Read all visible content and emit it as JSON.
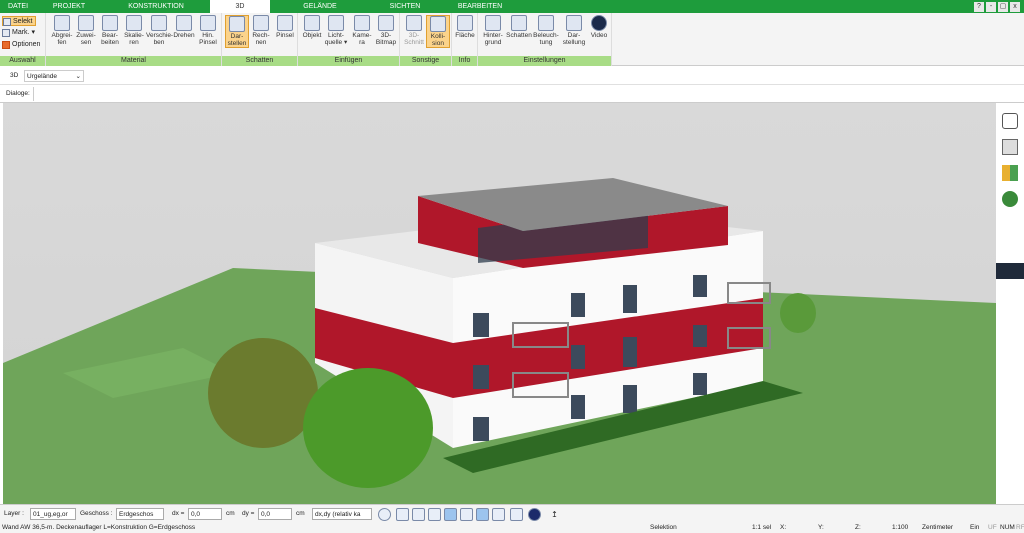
{
  "tabs": [
    "DATEI",
    "PROJEKT",
    "KONSTRUKTION",
    "3D",
    "GELÄNDE",
    "SICHTEN",
    "BEARBEITEN"
  ],
  "active_tab": "3D",
  "window_controls": [
    "?",
    "-",
    "▢",
    "x"
  ],
  "auswahl": {
    "selekt": "Selekt",
    "mark": "Mark.",
    "optionen": "Optionen",
    "group": "Auswahl"
  },
  "material": {
    "group": "Material",
    "buttons": [
      [
        "Abgrei-",
        "fen"
      ],
      [
        "Zuwei-",
        "sen"
      ],
      [
        "Bear-",
        "beiten"
      ],
      [
        "Skalie-",
        "ren"
      ],
      [
        "Verschie-",
        "ben"
      ],
      [
        "Drehen",
        ""
      ],
      [
        "Hin.",
        "Pinsel"
      ]
    ]
  },
  "schatten": {
    "group": "Schatten",
    "buttons": [
      [
        "Dar-",
        "stellen"
      ],
      [
        "Rech-",
        "nen"
      ],
      [
        "Pinsel",
        ""
      ]
    ]
  },
  "einfuegen": {
    "group": "Einfügen",
    "buttons": [
      [
        "Objekt",
        ""
      ],
      [
        "Licht-",
        "quelle"
      ],
      [
        "Kame-",
        "ra"
      ],
      [
        "3D-",
        "Bitmap"
      ]
    ]
  },
  "sonstige": {
    "group": "Sonstige",
    "buttons": [
      [
        "3D-",
        "Schnitt"
      ],
      [
        "Kolli-",
        "sion"
      ]
    ]
  },
  "info": {
    "group": "Info",
    "buttons": [
      [
        "Fläche",
        ""
      ]
    ]
  },
  "einstellungen": {
    "group": "Einstellungen",
    "buttons": [
      [
        "Hinter-",
        "grund"
      ],
      [
        "Schatten",
        ""
      ],
      [
        "Beleuch-",
        "tung"
      ],
      [
        "Dar-",
        "stellung"
      ],
      [
        "Video",
        ""
      ]
    ]
  },
  "viewbar": {
    "mode": "3D",
    "selected": "Urgelände"
  },
  "dialoge": "Dialoge:",
  "statusbar": {
    "layer_label": "Layer :",
    "layer_value": "01_ug,eg,or",
    "geschoss_label": "Geschoss :",
    "geschoss_value": "Erdgeschos",
    "dx_label": "dx =",
    "dx_value": "0,0",
    "dx_unit": "cm",
    "dy_label": "dy =",
    "dy_value": "0,0",
    "dy_unit": "cm",
    "mode_value": "dx,dy (relativ ka"
  },
  "statusline": {
    "text": "Wand AW 36,5-m. Deckenauflager L=Konstruktion G=Erdgeschoss",
    "mode": "Selektion",
    "sel": "1:1 sel",
    "x": "X:",
    "y": "Y:",
    "z": "Z:",
    "scale": "1:100",
    "unit": "Zentimeter",
    "ein": "Ein",
    "uf": "UF",
    "num": "NUM",
    "rf": "RF"
  },
  "colors": {
    "tab_green": "#1e9c3c",
    "group_green": "#a8dc86",
    "highlight": "#fbd38b",
    "facade_red": "#b0172a",
    "grass": "#6fa55a"
  }
}
